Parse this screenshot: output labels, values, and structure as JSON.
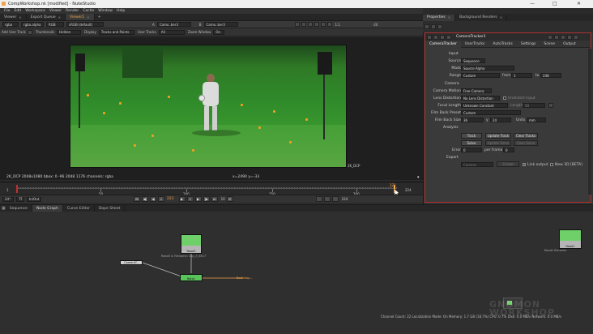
{
  "window": {
    "title": "CompWorkshop.nk [modified] - NukeStudio",
    "controls": [
      "—",
      "□",
      "✕"
    ]
  },
  "menu": [
    "File",
    "Edit",
    "Workspace",
    "Viewer",
    "Render",
    "Cache",
    "Window",
    "Help"
  ],
  "viewer_tabs": [
    {
      "label": "Viewer",
      "active": false
    },
    {
      "label": "Export Queue",
      "active": false
    },
    {
      "label": "Viewer1",
      "active": true
    }
  ],
  "viewer_toolbar1": {
    "channels": "rgba",
    "channel_sub": "rgba.alpha",
    "display": "RGB",
    "colorspace": "sRGB (default)",
    "input_a": "Camo..ber3",
    "input_b": "Camo..ber3",
    "zoom": "1:1",
    "fstop": "-20"
  },
  "viewer_toolbar2": {
    "add_user_track": "Add User Track",
    "thumbnails_label": "Thumbnails",
    "thumbnails_value": "Hidden",
    "display_label": "Display",
    "display_value": "Tracks and Points",
    "user_tracks_label": "User Tracks",
    "user_tracks_value": "All",
    "zoom_window_label": "Zoom Window",
    "zoom_window_value": "On"
  },
  "viewer": {
    "info": "2K_DCP 2048x1080  bbox: 0 -96 2048 1176 channels: rgba",
    "coords": "x=2490 y=-33",
    "format_label": "2K_DCP"
  },
  "timeline": {
    "start": "1",
    "ticks": [
      "50",
      "100",
      "150",
      "200"
    ],
    "end": "224",
    "current_frame": "221",
    "fps": "24*",
    "tf": "TF",
    "inout": "In/Out",
    "step": "10",
    "end2": "224"
  },
  "nodegraph_tabs": [
    "Sequence",
    "Node Graph",
    "Curve Editor",
    "Dope Sheet"
  ],
  "nodes": {
    "read3": {
      "label": "Read3",
      "sub": "(Clip_3_6517)"
    },
    "read1": {
      "label": "Read1"
    },
    "roto": {
      "label": "Roto1"
    },
    "backdrop": {
      "label": "Backdrop..."
    },
    "small_node": {
      "label": "CameraT.."
    },
    "read3_note": "Read3 in filename: Clip_3_6517",
    "read1_note": "Read1 filename"
  },
  "status": "Channel Count: 22  Localization Mode: On  Memory: 1.7 GB (18.7%)  CPU: 0.7%  Disk: 0.0 MB/s  Network: 0.0 MB/s",
  "watermark": "GNOMON WORKSHOP",
  "properties": {
    "tabs": [
      {
        "label": "Properties",
        "active": true
      },
      {
        "label": "Background Renders",
        "active": false
      }
    ],
    "node_name": "CameraTracker1",
    "node_tabs": [
      "CameraTracker",
      "UserTracks",
      "AutoTracks",
      "Settings",
      "Scene",
      "Output"
    ],
    "sections": {
      "input": "Input",
      "camera": "Camera",
      "analysis": "Analysis",
      "export": "Export"
    },
    "fields": {
      "source_label": "Source",
      "source_value": "Sequence",
      "mask_label": "Mask",
      "mask_value": "Source Alpha",
      "range_label": "Range",
      "range_value": "Custom",
      "from_label": "from",
      "from_value": "1",
      "to_label": "to",
      "to_value": "248",
      "camera_motion_label": "Camera Motion",
      "camera_motion_value": "Free Camera",
      "lens_distortion_label": "Lens Distortion",
      "lens_distortion_value": "No Lens Distortion",
      "undistort_label": "Undistort Input",
      "focal_length_label": "Focal Length",
      "focal_length_value": "Unknown Constant",
      "length_label": "Length",
      "length_value": "50",
      "film_back_preset_label": "Film Back Preset",
      "film_back_preset_value": "Custom",
      "film_back_size_label": "Film Back Size",
      "film_back_x": "36",
      "film_back_y_label": "y",
      "film_back_y": "24",
      "units_label": "Units",
      "units_value": "mm",
      "error_label": "Error",
      "error_value": "0",
      "per_frame_label": "per frame",
      "per_frame_value": "0",
      "export_value": "Camera",
      "link_output_label": "Link output",
      "new_3d_label": "New 3D [BETA]"
    },
    "buttons": {
      "track": "Track",
      "update_track": "Update Track",
      "clear_tracks": "Clear Tracks",
      "solve": "Solve",
      "update_solve": "Update Solve",
      "clear_solve": "Clear Solve",
      "create": "Create"
    }
  }
}
